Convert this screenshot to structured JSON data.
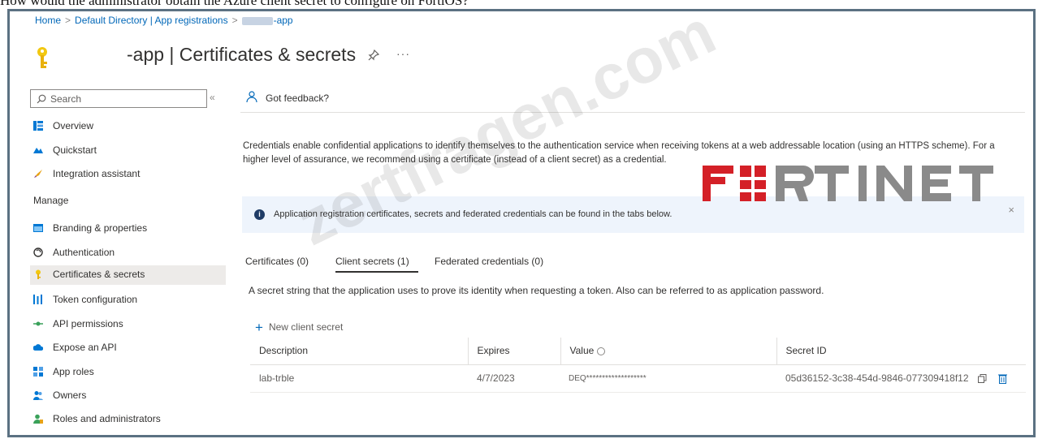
{
  "question": "How would the administrator obtain the Azure client secret to configure on FortiOS?",
  "breadcrumb": {
    "home": "Home",
    "directory": "Default Directory | App registrations",
    "app": "-app"
  },
  "page": {
    "title": "-app | Certificates & secrets",
    "more": "···"
  },
  "sidebar": {
    "search_placeholder": "Search",
    "collapse": "«",
    "items_top": [
      {
        "label": "Overview",
        "icon": "overview-icon"
      },
      {
        "label": "Quickstart",
        "icon": "quickstart-icon"
      },
      {
        "label": "Integration assistant",
        "icon": "rocket-icon"
      }
    ],
    "manage_label": "Manage",
    "items_manage": [
      {
        "label": "Branding & properties",
        "icon": "branding-icon"
      },
      {
        "label": "Authentication",
        "icon": "authentication-icon"
      },
      {
        "label": "Certificates & secrets",
        "icon": "key-icon",
        "active": true
      },
      {
        "label": "Token configuration",
        "icon": "token-icon"
      },
      {
        "label": "API permissions",
        "icon": "api-permissions-icon"
      },
      {
        "label": "Expose an API",
        "icon": "cloud-icon"
      },
      {
        "label": "App roles",
        "icon": "app-roles-icon"
      },
      {
        "label": "Owners",
        "icon": "owners-icon"
      },
      {
        "label": "Roles and administrators",
        "icon": "roles-icon"
      }
    ]
  },
  "main": {
    "feedback": "Got feedback?",
    "description": "Credentials enable confidential applications to identify themselves to the authentication service when receiving tokens at a web addressable location (using an HTTPS scheme). For a higher level of assurance, we recommend using a certificate (instead of a client secret) as a credential.",
    "info": "Application registration certificates, secrets and federated credentials can be found in the tabs below.",
    "info_close": "×",
    "tabs": [
      "Certificates (0)",
      "Client secrets (1)",
      "Federated credentials (0)"
    ],
    "secret_description": "A secret string that the application uses to prove its identity when requesting a token. Also can be referred to as application password.",
    "new_secret": "New client secret",
    "columns": [
      "Description",
      "Expires",
      "Value",
      "Secret ID"
    ],
    "rows": [
      {
        "description": "lab-trble",
        "expires": "4/7/2023",
        "value": "DEQ*******************",
        "secret_id": "05d36152-3c38-454d-9846-077309418f12"
      }
    ]
  },
  "watermark": {
    "site": "zertfragen.com",
    "logo": "FORTINET"
  },
  "colors": {
    "accent": "#0067b8",
    "frame": "#5b7182",
    "info_bg": "#eef4fc",
    "fortinet_red": "#d42027"
  }
}
